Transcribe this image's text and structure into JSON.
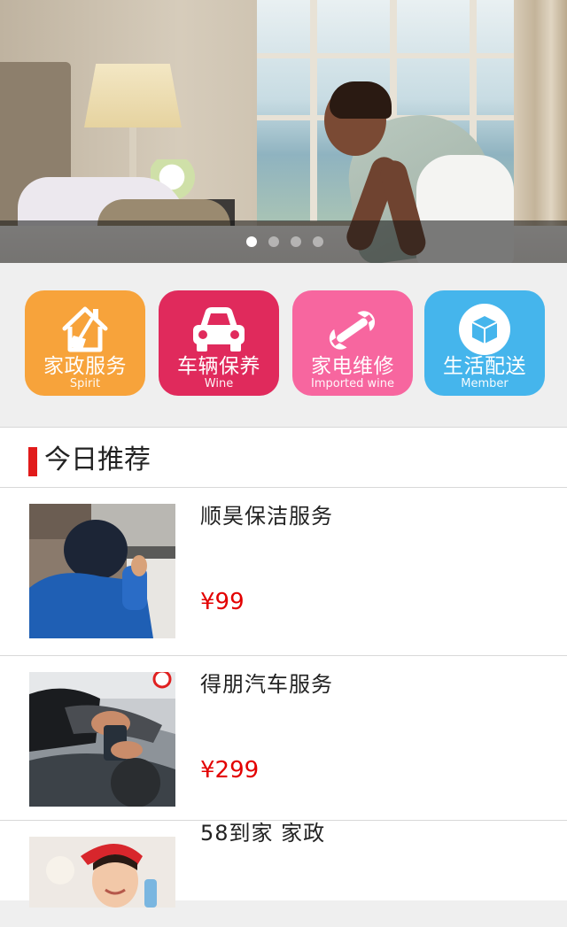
{
  "banner": {
    "slide_count": 4,
    "active_index": 0
  },
  "categories": [
    {
      "title": "家政服务",
      "subtitle": "Spirit",
      "color": "#f7a33b",
      "icon": "house-broom-icon"
    },
    {
      "title": "车辆保养",
      "subtitle": "Wine",
      "color": "#e02a5c",
      "icon": "car-icon"
    },
    {
      "title": "家电维修",
      "subtitle": "Imported wine",
      "color": "#f7669f",
      "icon": "wrench-icon"
    },
    {
      "title": "生活配送",
      "subtitle": "Member",
      "color": "#45b5ec",
      "icon": "box-icon"
    }
  ],
  "recommend": {
    "title": "今日推荐",
    "accent_color": "#e11b1b",
    "items": [
      {
        "name": "顺昊保洁服务",
        "price": "¥99"
      },
      {
        "name": "得朋汽车服务",
        "price": "¥299"
      },
      {
        "name": "58到家 家政",
        "price": ""
      }
    ]
  }
}
